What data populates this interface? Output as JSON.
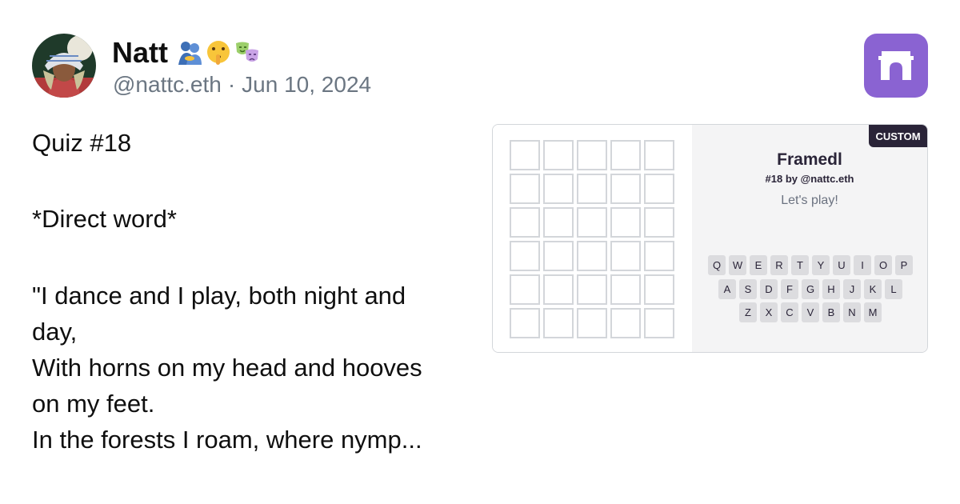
{
  "author": {
    "name": "Natt",
    "handle": "@nattc.eth",
    "separator": "·",
    "date": "Jun 10, 2024"
  },
  "post": {
    "paragraphs": [
      [
        "Quiz #18"
      ],
      [
        "*Direct word*"
      ],
      [
        "\"I dance and I play, both night and",
        "day,",
        "With horns on my head and hooves",
        "on my feet.",
        "In the forests I roam, where nymp..."
      ]
    ]
  },
  "embed": {
    "badge": "CUSTOM",
    "title": "Framedl",
    "subtitle": "#18 by @nattc.eth",
    "status": "Let's play!",
    "grid": {
      "rows": 6,
      "cols": 5
    },
    "keyboard": [
      [
        "Q",
        "W",
        "E",
        "R",
        "T",
        "Y",
        "U",
        "I",
        "O",
        "P"
      ],
      [
        "A",
        "S",
        "D",
        "F",
        "G",
        "H",
        "J",
        "K",
        "L"
      ],
      [
        "Z",
        "X",
        "C",
        "V",
        "B",
        "N",
        "M"
      ]
    ]
  },
  "colors": {
    "brand": "#8a63d2",
    "badge_bg": "#2a2438",
    "tile_border": "#d3d6da",
    "key_bg": "#dcdcdf"
  },
  "icons": {
    "name_emojis": [
      "people-hugging-icon",
      "shushing-face-icon",
      "performing-arts-icon"
    ],
    "app_logo": "farcaster-arch-icon"
  }
}
